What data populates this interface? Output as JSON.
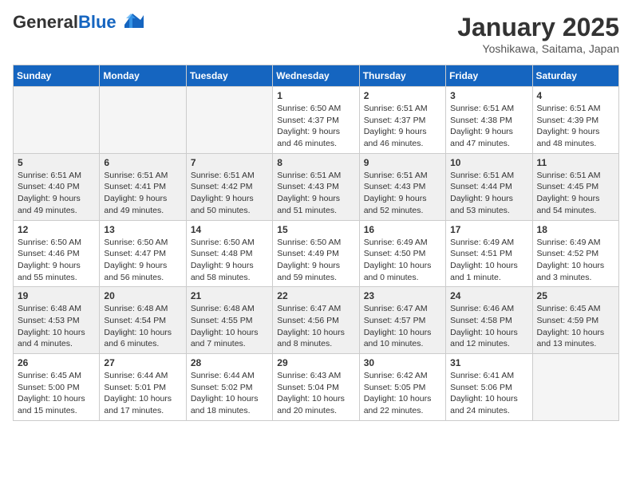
{
  "header": {
    "logo_line1": "General",
    "logo_line2": "Blue",
    "month": "January 2025",
    "location": "Yoshikawa, Saitama, Japan"
  },
  "weekdays": [
    "Sunday",
    "Monday",
    "Tuesday",
    "Wednesday",
    "Thursday",
    "Friday",
    "Saturday"
  ],
  "weeks": [
    {
      "shaded": false,
      "days": [
        {
          "num": "",
          "detail": ""
        },
        {
          "num": "",
          "detail": ""
        },
        {
          "num": "",
          "detail": ""
        },
        {
          "num": "1",
          "detail": "Sunrise: 6:50 AM\nSunset: 4:37 PM\nDaylight: 9 hours\nand 46 minutes."
        },
        {
          "num": "2",
          "detail": "Sunrise: 6:51 AM\nSunset: 4:37 PM\nDaylight: 9 hours\nand 46 minutes."
        },
        {
          "num": "3",
          "detail": "Sunrise: 6:51 AM\nSunset: 4:38 PM\nDaylight: 9 hours\nand 47 minutes."
        },
        {
          "num": "4",
          "detail": "Sunrise: 6:51 AM\nSunset: 4:39 PM\nDaylight: 9 hours\nand 48 minutes."
        }
      ]
    },
    {
      "shaded": true,
      "days": [
        {
          "num": "5",
          "detail": "Sunrise: 6:51 AM\nSunset: 4:40 PM\nDaylight: 9 hours\nand 49 minutes."
        },
        {
          "num": "6",
          "detail": "Sunrise: 6:51 AM\nSunset: 4:41 PM\nDaylight: 9 hours\nand 49 minutes."
        },
        {
          "num": "7",
          "detail": "Sunrise: 6:51 AM\nSunset: 4:42 PM\nDaylight: 9 hours\nand 50 minutes."
        },
        {
          "num": "8",
          "detail": "Sunrise: 6:51 AM\nSunset: 4:43 PM\nDaylight: 9 hours\nand 51 minutes."
        },
        {
          "num": "9",
          "detail": "Sunrise: 6:51 AM\nSunset: 4:43 PM\nDaylight: 9 hours\nand 52 minutes."
        },
        {
          "num": "10",
          "detail": "Sunrise: 6:51 AM\nSunset: 4:44 PM\nDaylight: 9 hours\nand 53 minutes."
        },
        {
          "num": "11",
          "detail": "Sunrise: 6:51 AM\nSunset: 4:45 PM\nDaylight: 9 hours\nand 54 minutes."
        }
      ]
    },
    {
      "shaded": false,
      "days": [
        {
          "num": "12",
          "detail": "Sunrise: 6:50 AM\nSunset: 4:46 PM\nDaylight: 9 hours\nand 55 minutes."
        },
        {
          "num": "13",
          "detail": "Sunrise: 6:50 AM\nSunset: 4:47 PM\nDaylight: 9 hours\nand 56 minutes."
        },
        {
          "num": "14",
          "detail": "Sunrise: 6:50 AM\nSunset: 4:48 PM\nDaylight: 9 hours\nand 58 minutes."
        },
        {
          "num": "15",
          "detail": "Sunrise: 6:50 AM\nSunset: 4:49 PM\nDaylight: 9 hours\nand 59 minutes."
        },
        {
          "num": "16",
          "detail": "Sunrise: 6:49 AM\nSunset: 4:50 PM\nDaylight: 10 hours\nand 0 minutes."
        },
        {
          "num": "17",
          "detail": "Sunrise: 6:49 AM\nSunset: 4:51 PM\nDaylight: 10 hours\nand 1 minute."
        },
        {
          "num": "18",
          "detail": "Sunrise: 6:49 AM\nSunset: 4:52 PM\nDaylight: 10 hours\nand 3 minutes."
        }
      ]
    },
    {
      "shaded": true,
      "days": [
        {
          "num": "19",
          "detail": "Sunrise: 6:48 AM\nSunset: 4:53 PM\nDaylight: 10 hours\nand 4 minutes."
        },
        {
          "num": "20",
          "detail": "Sunrise: 6:48 AM\nSunset: 4:54 PM\nDaylight: 10 hours\nand 6 minutes."
        },
        {
          "num": "21",
          "detail": "Sunrise: 6:48 AM\nSunset: 4:55 PM\nDaylight: 10 hours\nand 7 minutes."
        },
        {
          "num": "22",
          "detail": "Sunrise: 6:47 AM\nSunset: 4:56 PM\nDaylight: 10 hours\nand 8 minutes."
        },
        {
          "num": "23",
          "detail": "Sunrise: 6:47 AM\nSunset: 4:57 PM\nDaylight: 10 hours\nand 10 minutes."
        },
        {
          "num": "24",
          "detail": "Sunrise: 6:46 AM\nSunset: 4:58 PM\nDaylight: 10 hours\nand 12 minutes."
        },
        {
          "num": "25",
          "detail": "Sunrise: 6:45 AM\nSunset: 4:59 PM\nDaylight: 10 hours\nand 13 minutes."
        }
      ]
    },
    {
      "shaded": false,
      "days": [
        {
          "num": "26",
          "detail": "Sunrise: 6:45 AM\nSunset: 5:00 PM\nDaylight: 10 hours\nand 15 minutes."
        },
        {
          "num": "27",
          "detail": "Sunrise: 6:44 AM\nSunset: 5:01 PM\nDaylight: 10 hours\nand 17 minutes."
        },
        {
          "num": "28",
          "detail": "Sunrise: 6:44 AM\nSunset: 5:02 PM\nDaylight: 10 hours\nand 18 minutes."
        },
        {
          "num": "29",
          "detail": "Sunrise: 6:43 AM\nSunset: 5:04 PM\nDaylight: 10 hours\nand 20 minutes."
        },
        {
          "num": "30",
          "detail": "Sunrise: 6:42 AM\nSunset: 5:05 PM\nDaylight: 10 hours\nand 22 minutes."
        },
        {
          "num": "31",
          "detail": "Sunrise: 6:41 AM\nSunset: 5:06 PM\nDaylight: 10 hours\nand 24 minutes."
        },
        {
          "num": "",
          "detail": ""
        }
      ]
    }
  ]
}
